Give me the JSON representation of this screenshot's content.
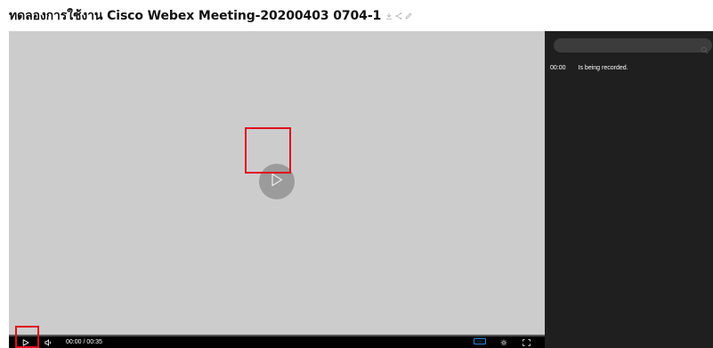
{
  "header": {
    "title": "ทดลองการใช้งาน Cisco Webex Meeting-20200403 0704-1",
    "icons": [
      "download-icon",
      "share-icon",
      "edit-icon"
    ]
  },
  "player": {
    "big_play_icon": "play-icon",
    "controls": {
      "play_icon": "play-icon",
      "volume_icon": "volume-icon",
      "time": "00:00 / 00:35",
      "progress": 0.0,
      "cc_label": "CC",
      "settings_icon": "gear-icon",
      "fullscreen_icon": "fullscreen-icon"
    }
  },
  "sidebar": {
    "search": {
      "value": "",
      "placeholder": ""
    },
    "transcript": [
      {
        "time": "00:00",
        "text": "Is being recorded."
      }
    ]
  },
  "colors": {
    "player_bg": "#cccccc",
    "sidebar_bg": "#1f1f1f",
    "highlight": "#e10e1c",
    "cc_accent": "#2d86d6"
  }
}
